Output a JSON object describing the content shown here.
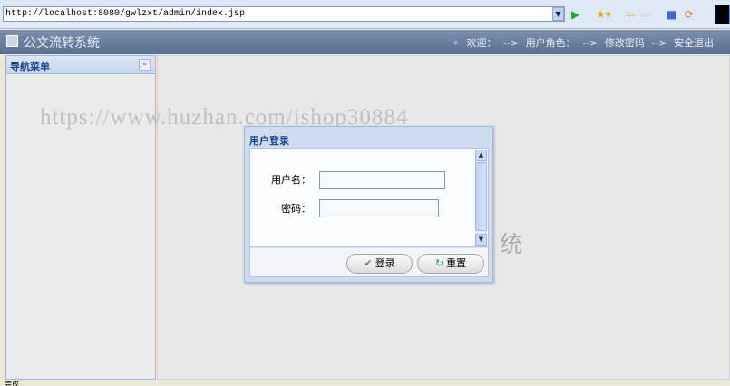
{
  "browser": {
    "url": "http://localhost:8080/gwlzxt/admin/index.jsp"
  },
  "header": {
    "title": "公文流转系统",
    "welcome": "欢迎：",
    "welcome_value": "-->",
    "role": "用户角色：",
    "role_value": "-->",
    "change_password": "修改密码",
    "logout_arrow": "-->",
    "logout": "安全退出"
  },
  "sidebar": {
    "title": "导航菜单",
    "collapse": "«"
  },
  "watermark": "https://www.huzhan.com/ishop30884",
  "background_title": "统",
  "dialog": {
    "title": "用户登录",
    "username_label": "用户名：",
    "username_value": "",
    "password_label": "密码：",
    "password_value": "",
    "login": "登录",
    "reset": "重置"
  },
  "status": {
    "text": "完成"
  }
}
